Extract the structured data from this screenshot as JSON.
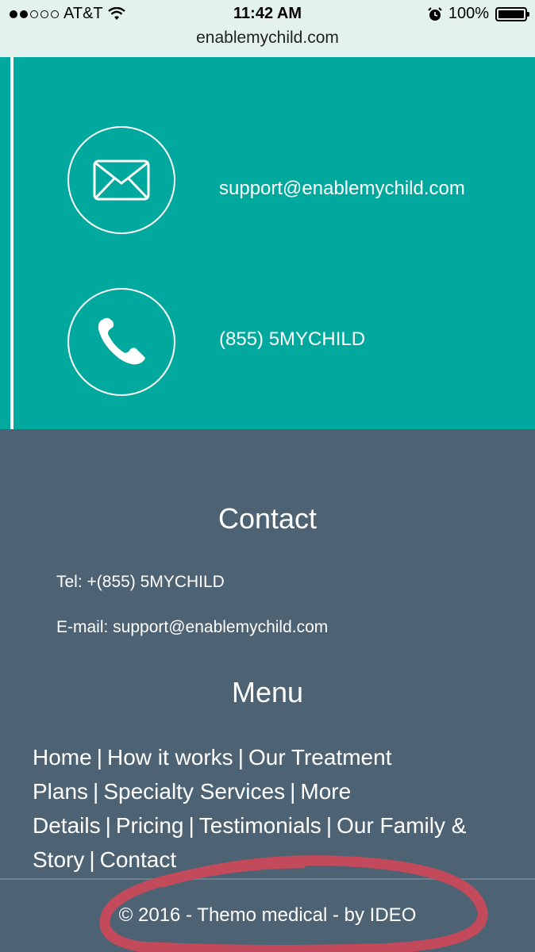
{
  "status_bar": {
    "carrier": "AT&T",
    "time": "11:42 AM",
    "battery": "100%",
    "url": "enablemychild.com"
  },
  "contact_section": {
    "email": "support@enablemychild.com",
    "phone": "(855) 5MYCHILD"
  },
  "footer": {
    "contact_heading": "Contact",
    "tel_line": "Tel: +(855) 5MYCHILD",
    "email_line": "E-mail:  support@enablemychild.com",
    "menu_heading": "Menu",
    "menu_items": [
      "Home",
      "How it works",
      "Our Treatment Plans",
      "Specialty Services",
      "More Details",
      "Pricing",
      "Testimonials",
      "Our Family & Story",
      "Contact"
    ],
    "copyright": "© 2016 - Themo medical - by IDEO"
  },
  "colors": {
    "teal": "#00a89d",
    "footer_bg": "#4d6374",
    "annotation": "#c24a5a"
  },
  "icons": [
    "signal-dots-icon",
    "wifi-icon",
    "alarm-icon",
    "battery-icon",
    "envelope-icon",
    "phone-icon"
  ]
}
